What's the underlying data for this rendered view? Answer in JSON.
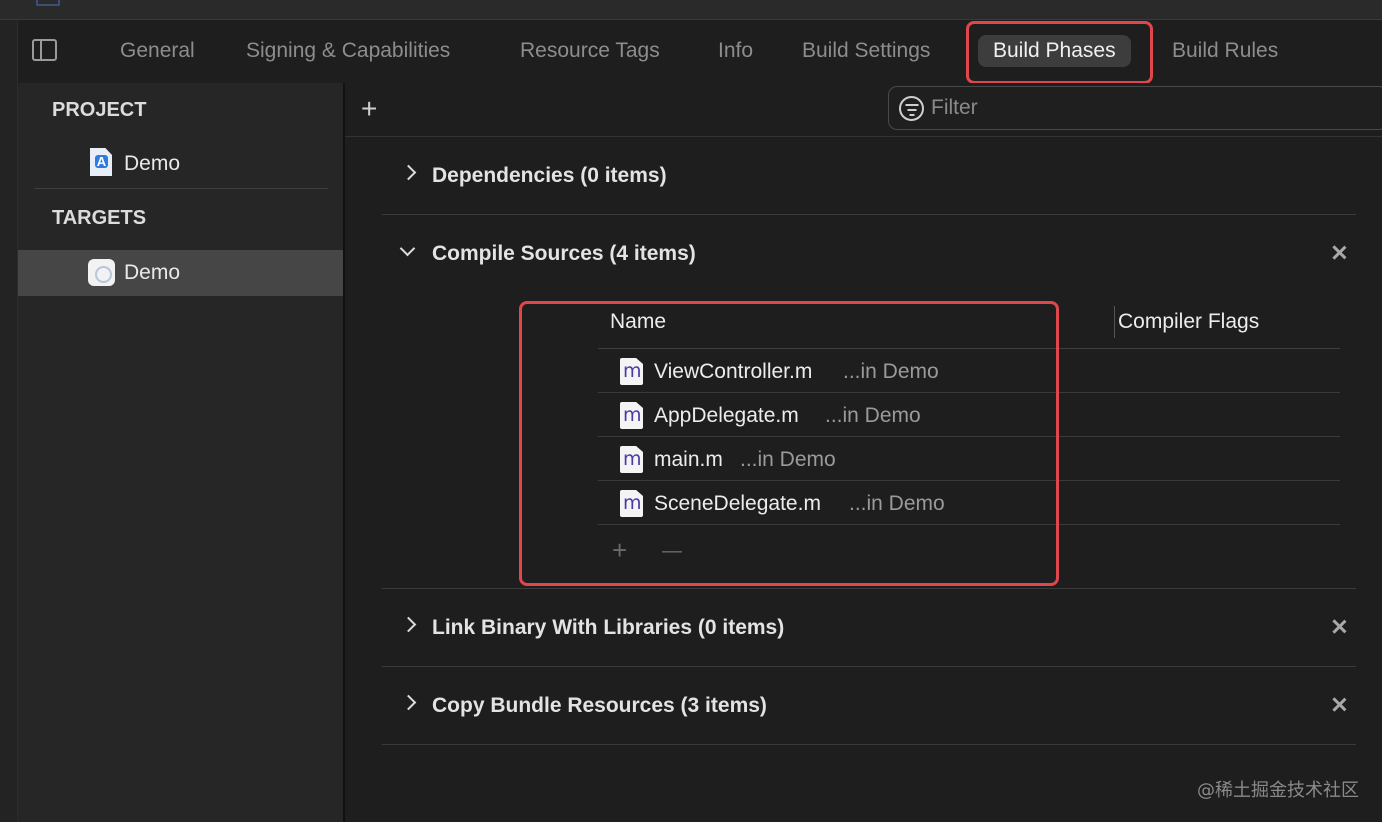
{
  "tabs": [
    {
      "label": "General",
      "active": false
    },
    {
      "label": "Signing & Capabilities",
      "active": false
    },
    {
      "label": "Resource Tags",
      "active": false
    },
    {
      "label": "Info",
      "active": false
    },
    {
      "label": "Build Settings",
      "active": false
    },
    {
      "label": "Build Phases",
      "active": true
    },
    {
      "label": "Build Rules",
      "active": false
    }
  ],
  "sidebar": {
    "project_header": "PROJECT",
    "project_item": "Demo",
    "targets_header": "TARGETS",
    "target_item": "Demo"
  },
  "toolbar": {
    "add_label": "+",
    "filter_placeholder": "Filter"
  },
  "phases": [
    {
      "title": "Dependencies (0 items)",
      "expanded": false,
      "removable": false
    },
    {
      "title": "Compile Sources (4 items)",
      "expanded": true,
      "removable": true
    },
    {
      "title": "Link Binary With Libraries (0 items)",
      "expanded": false,
      "removable": true
    },
    {
      "title": "Copy Bundle Resources (3 items)",
      "expanded": false,
      "removable": true
    }
  ],
  "compile_sources": {
    "columns": {
      "name": "Name",
      "flags": "Compiler Flags"
    },
    "files": [
      {
        "icon": "m",
        "name": "ViewController.m",
        "location": "...in Demo"
      },
      {
        "icon": "m",
        "name": "AppDelegate.m",
        "location": "...in Demo"
      },
      {
        "icon": "m",
        "name": "main.m",
        "location": "...in Demo"
      },
      {
        "icon": "m",
        "name": "SceneDelegate.m",
        "location": "...in Demo"
      }
    ],
    "add_label": "+",
    "remove_label": "—"
  },
  "watermark": "@稀土掘金技术社区",
  "colors": {
    "background": "#1e1e1e",
    "sidebar": "#262626",
    "selected_row": "#464646",
    "highlight": "#e0474c",
    "active_tab": "#3d3d3d"
  },
  "icons": [
    "sidebar-toggle-icon",
    "project-file-icon",
    "app-target-icon",
    "filter-icon",
    "disclosure-chevron-icon",
    "close-icon",
    "objc-m-file-icon"
  ]
}
